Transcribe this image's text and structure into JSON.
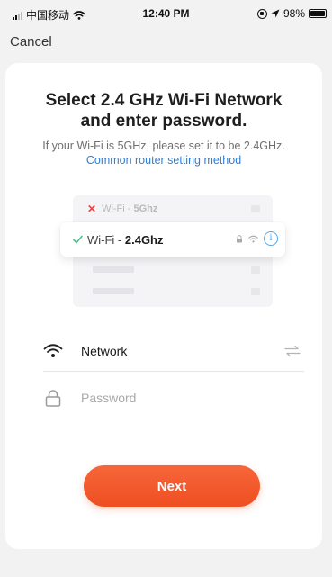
{
  "status_bar": {
    "carrier": "中国移动",
    "time": "12:40 PM",
    "battery": "98%",
    "battery_level": 0.98
  },
  "nav": {
    "cancel_label": "Cancel"
  },
  "main": {
    "title_line1": "Select 2.4 GHz Wi-Fi Network",
    "title_line2": "and enter password.",
    "subtitle": "If your Wi-Fi is 5GHz, please set it to be 2.4GHz.",
    "subtitle_link": "Common router setting method"
  },
  "illustration": {
    "wifi5_prefix": "Wi-Fi - ",
    "wifi5_band": "5Ghz",
    "wifi24_prefix": "Wi-Fi - ",
    "wifi24_band": "2.4Ghz",
    "colors": {
      "reject": "#e8474c",
      "accept": "#4cbf8a",
      "info": "#55a7ea"
    }
  },
  "form": {
    "network_value": "Network",
    "password_placeholder": "Password",
    "password_value": ""
  },
  "actions": {
    "next_label": "Next",
    "accent": "#f25a2a"
  },
  "icons": {
    "status_wifi": "wifi-icon",
    "rotation_lock": "rotation-lock-icon",
    "location": "location-arrow-icon",
    "battery": "battery-icon",
    "reject": "x-icon",
    "accept": "check-icon",
    "lock": "lock-icon",
    "info": "info-icon",
    "network_field": "wifi-icon",
    "password_field": "lock-icon",
    "switch_network": "swap-arrows-icon"
  }
}
